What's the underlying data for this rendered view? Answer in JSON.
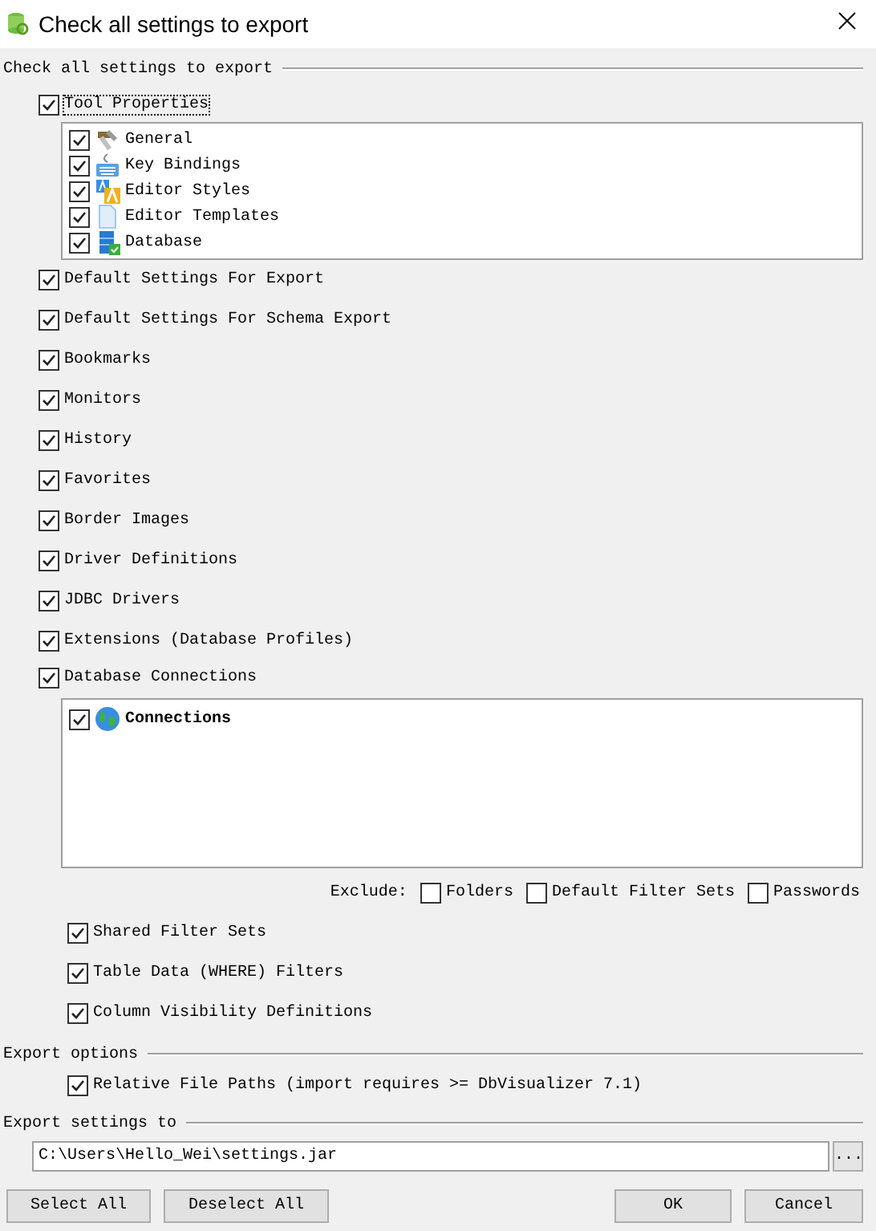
{
  "window": {
    "title": "Check all settings to export"
  },
  "settings_section": {
    "title": "Check all settings to export",
    "items": [
      {
        "kind": "tree",
        "label": "Tool Properties",
        "checked": true,
        "focused": true,
        "children": [
          {
            "label": "General",
            "checked": true
          },
          {
            "label": "Key Bindings",
            "checked": true
          },
          {
            "label": "Editor Styles",
            "checked": true
          },
          {
            "label": "Editor Templates",
            "checked": true
          },
          {
            "label": "Database",
            "checked": true
          }
        ]
      },
      {
        "kind": "plain",
        "label": "Default Settings For Export",
        "checked": true
      },
      {
        "kind": "plain",
        "label": "Default Settings For Schema Export",
        "checked": true
      },
      {
        "kind": "plain",
        "label": "Bookmarks",
        "checked": true
      },
      {
        "kind": "plain",
        "label": "Monitors",
        "checked": true
      },
      {
        "kind": "plain",
        "label": "History",
        "checked": true
      },
      {
        "kind": "plain",
        "label": "Favorites",
        "checked": true
      },
      {
        "kind": "plain",
        "label": "Border Images",
        "checked": true
      },
      {
        "kind": "plain",
        "label": "Driver Definitions",
        "checked": true
      },
      {
        "kind": "plain",
        "label": "JDBC Drivers",
        "checked": true
      },
      {
        "kind": "plain",
        "label": "Extensions (Database Profiles)",
        "checked": true
      },
      {
        "kind": "connections",
        "label": "Database Connections",
        "checked": true,
        "children": [
          {
            "label": "Connections",
            "checked": true
          }
        ]
      }
    ],
    "exclude": {
      "label": "Exclude:",
      "options": [
        {
          "label": "Folders",
          "checked": false
        },
        {
          "label": "Default Filter Sets",
          "checked": false
        },
        {
          "label": "Passwords",
          "checked": false
        }
      ]
    },
    "connection_options": [
      {
        "label": "Shared Filter Sets",
        "checked": true
      },
      {
        "label": "Table Data (WHERE) Filters",
        "checked": true
      },
      {
        "label": "Column Visibility Definitions",
        "checked": true
      }
    ]
  },
  "export_options": {
    "title": "Export options",
    "options": [
      {
        "label": "Relative File Paths (import requires >= DbVisualizer 7.1)",
        "checked": true
      }
    ]
  },
  "export_to": {
    "title": "Export settings to",
    "value": "C:\\Users\\Hello_Wei\\settings.jar",
    "browse": "..."
  },
  "buttons_left": [
    "Select All",
    "Deselect All"
  ],
  "buttons_right": [
    "OK",
    "Cancel"
  ]
}
